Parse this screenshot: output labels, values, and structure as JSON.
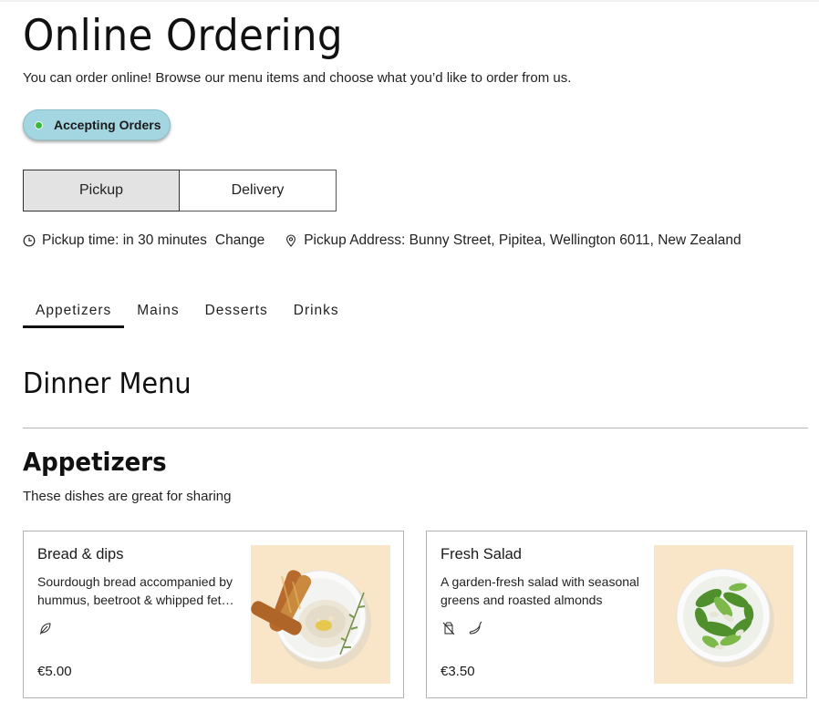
{
  "header": {
    "title": "Online Ordering",
    "subtitle": "You can order online! Browse our menu items and choose what you’d like to order from us."
  },
  "status": {
    "label": "Accepting Orders",
    "dot_color": "#3ab83a",
    "pill_color": "#a4d6e1"
  },
  "fulfillment": {
    "options": [
      {
        "label": "Pickup",
        "selected": true
      },
      {
        "label": "Delivery",
        "selected": false
      }
    ]
  },
  "pickup_info": {
    "time_icon": "clock-icon",
    "time_text": "Pickup time: in 30 minutes",
    "change_label": "Change",
    "address_icon": "location-pin-icon",
    "address_text": "Pickup Address: Bunny Street, Pipitea, Wellington 6011, New Zealand"
  },
  "tabs": [
    {
      "label": "Appetizers",
      "active": true
    },
    {
      "label": "Mains",
      "active": false
    },
    {
      "label": "Desserts",
      "active": false
    },
    {
      "label": "Drinks",
      "active": false
    }
  ],
  "menu": {
    "title": "Dinner Menu",
    "section": {
      "title": "Appetizers",
      "description": "These dishes are great for sharing",
      "items": [
        {
          "name": "Bread & dips",
          "description": "Sourdough bread accompanied by hummus, beetroot & whipped fet…",
          "icons": [
            "vegetarian-leaf-icon"
          ],
          "price": "€5.00",
          "image": "bread-and-hummus-plate"
        },
        {
          "name": "Fresh Salad",
          "description": "A garden-fresh salad with seasonal greens and roasted almonds",
          "icons": [
            "dairy-free-icon",
            "spicy-chili-icon"
          ],
          "price": "€3.50",
          "image": "green-salad-plate"
        }
      ]
    }
  }
}
